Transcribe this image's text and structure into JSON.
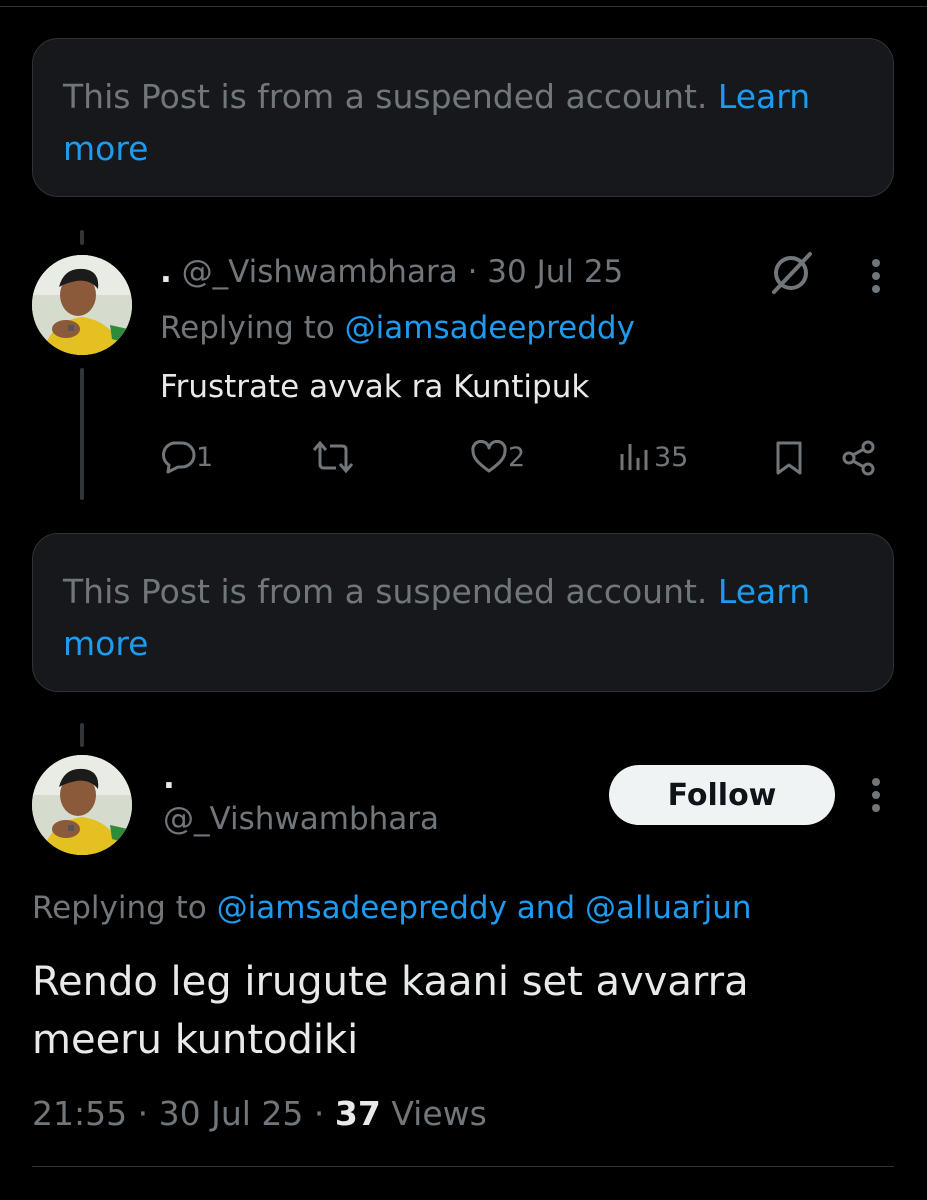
{
  "suspended_notice_1": {
    "text": "This Post is from a suspended account. ",
    "link": "Learn more"
  },
  "reply_1": {
    "display_name": ".",
    "handle": "@_Vishwambhara",
    "date": "30 Jul 25",
    "replying_label": "Replying to",
    "replying_handle": "@iamsadeepreddy",
    "text": "Frustrate avvak ra Kuntipuk",
    "replies": "1",
    "reposts": "",
    "likes": "2",
    "views": "35",
    "icons": [
      "grok-icon",
      "more-icon",
      "reply-icon",
      "repost-icon",
      "like-icon",
      "views-icon",
      "bookmark-icon",
      "share-icon"
    ]
  },
  "suspended_notice_2": {
    "text": "This Post is from a suspended account. ",
    "link": "Learn more"
  },
  "main_post": {
    "display_name": ".",
    "handle": "@_Vishwambhara",
    "follow_label": "Follow",
    "replying_label": "Replying to",
    "replying_handle_1": "@iamsadeepreddy",
    "replying_and": "and",
    "replying_handle_2": "@alluarjun",
    "text_line_1": "Rendo leg irugute kaani set avvarra",
    "text_line_2": "meeru kuntodiki",
    "time": "21:55",
    "date": "30 Jul 25",
    "views_count": "37",
    "views_label": "Views"
  },
  "colors": {
    "accent": "#1d9bf0",
    "muted": "#71767b",
    "text": "#e7e9ea",
    "background": "#000000",
    "card": "#16181c"
  }
}
